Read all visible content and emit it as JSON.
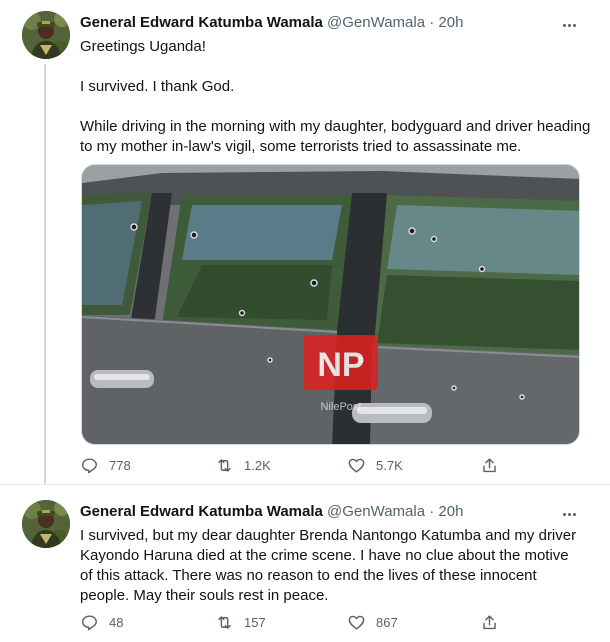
{
  "tweets": [
    {
      "name": "General Edward Katumba Wamala",
      "handle": "@GenWamala",
      "separator": "·",
      "time": "20h",
      "paragraphs": [
        "Greetings Uganda!",
        "I survived. I thank God.",
        "While driving in the morning with my daughter, bodyguard and driver heading to my mother in-law's vigil, some terrorists tried to assassinate me."
      ],
      "media_watermark": "NP",
      "media_watermark_sub": "NilePost",
      "stats": {
        "replies": "778",
        "retweets": "1.2K",
        "likes": "5.7K"
      }
    },
    {
      "name": "General Edward Katumba Wamala",
      "handle": "@GenWamala",
      "separator": "·",
      "time": "20h",
      "paragraphs": [
        "I survived, but my dear daughter Brenda Nantongo Katumba and my driver Kayondo Haruna died at the crime scene. I have no clue about the motive of this attack. There was no reason to end the lives of these innocent people. May their souls rest in peace."
      ],
      "stats": {
        "replies": "48",
        "retweets": "157",
        "likes": "867"
      }
    }
  ],
  "icons": {
    "more": "more-icon",
    "reply": "reply-icon",
    "retweet": "retweet-icon",
    "like": "like-icon",
    "share": "share-icon"
  },
  "colors": {
    "text": "#0f1419",
    "secondary": "#536471",
    "divider": "#e6ecf0",
    "thread_line": "#cfd9de",
    "watermark_red": "#e02020"
  }
}
